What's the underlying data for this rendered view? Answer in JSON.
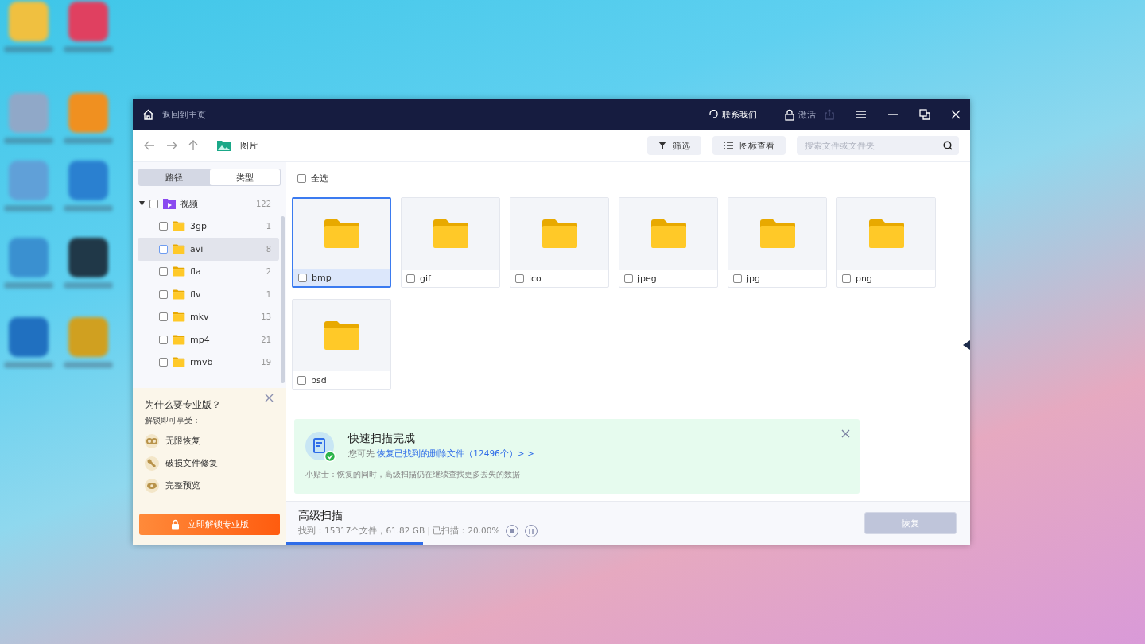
{
  "titlebar": {
    "home_label": "返回到主页",
    "contact": "联系我们",
    "activate": "激活"
  },
  "toolbar": {
    "location": "图片",
    "filter": "筛选",
    "view": "图标查看",
    "search_placeholder": "搜索文件或文件夹"
  },
  "sidebar": {
    "tabs": [
      {
        "label": "路径",
        "selected": false
      },
      {
        "label": "类型",
        "selected": true
      }
    ],
    "tree": [
      {
        "label": "视频",
        "count": "122",
        "expanded": true,
        "checked": false,
        "selected": false,
        "children": [
          {
            "label": "3gp",
            "count": "1",
            "checked": false,
            "selected": false
          },
          {
            "label": "avi",
            "count": "8",
            "checked": false,
            "selected": true
          },
          {
            "label": "fla",
            "count": "2",
            "checked": false,
            "selected": false
          },
          {
            "label": "flv",
            "count": "1",
            "checked": false,
            "selected": false
          },
          {
            "label": "mkv",
            "count": "13",
            "checked": false,
            "selected": false
          },
          {
            "label": "mp4",
            "count": "21",
            "checked": false,
            "selected": false
          },
          {
            "label": "rmvb",
            "count": "19",
            "checked": false,
            "selected": false
          }
        ]
      }
    ]
  },
  "promo": {
    "title": "为什么要专业版？",
    "subtitle": "解锁即可享受：",
    "features": [
      "无限恢复",
      "破损文件修复",
      "完整预览"
    ],
    "button": "立即解锁专业版"
  },
  "select_all": {
    "label": "全选",
    "checked": false
  },
  "folders": [
    {
      "name": "bmp",
      "selected": true,
      "checked": false
    },
    {
      "name": "gif",
      "selected": false,
      "checked": false
    },
    {
      "name": "ico",
      "selected": false,
      "checked": false
    },
    {
      "name": "jpeg",
      "selected": false,
      "checked": false
    },
    {
      "name": "jpg",
      "selected": false,
      "checked": false
    },
    {
      "name": "png",
      "selected": false,
      "checked": false
    },
    {
      "name": "psd",
      "selected": false,
      "checked": false
    }
  ],
  "notice": {
    "title": "快速扫描完成",
    "prefix": "您可先",
    "link": "恢复已找到的删除文件（12496个）> >",
    "tip": "小贴士：恢复的同时，高级扫描仍在继续查找更多丢失的数据"
  },
  "scan": {
    "title": "高级扫描",
    "status": "找到：15317个文件，61.82 GB | 已扫描：20.00%",
    "level": 0.2
  },
  "recover_button": {
    "label": "恢复",
    "disabled": true
  }
}
